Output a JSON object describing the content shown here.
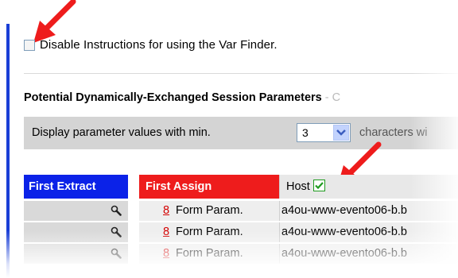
{
  "instructions": {
    "checkbox_label": "Disable Instructions for using the Var Finder.",
    "checked": false
  },
  "section": {
    "title": "Potential Dynamically-Exchanged Session Parameters",
    "title_tail": " - C"
  },
  "filter": {
    "prefix": "Display parameter values with min.",
    "selected_value": "3",
    "suffix": "characters wi"
  },
  "table": {
    "headers": {
      "first_extract": "First Extract",
      "first_assign": "First Assign",
      "host": "Host"
    },
    "host_checked": true,
    "rows": [
      {
        "assign_num": "8",
        "assign_src": "Form Param.",
        "host": "a4ou-www-evento06-b.b"
      },
      {
        "assign_num": "8",
        "assign_src": "Form Param.",
        "host": "a4ou-www-evento06-b.b"
      },
      {
        "assign_num": "8",
        "assign_src": "Form Param.",
        "host": "a4ou-www-evento06-b.b"
      }
    ]
  },
  "colors": {
    "first_extract_bg": "#0b22e8",
    "first_assign_bg": "#ee1c1c",
    "annotation_arrow": "#ee1c1c"
  }
}
